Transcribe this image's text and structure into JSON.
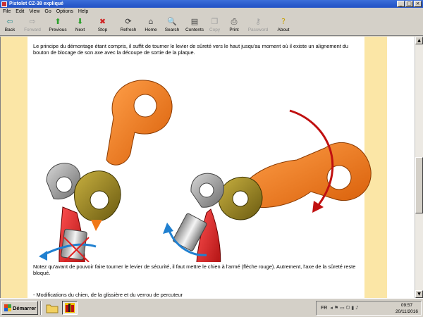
{
  "window": {
    "title": "Pistolet CZ-38 expliqué"
  },
  "menu": [
    "File",
    "Edit",
    "View",
    "Go",
    "Options",
    "Help"
  ],
  "toolbar": [
    {
      "label": "Back",
      "icon": "back-arrow-icon",
      "glyph": "⇦",
      "color": "#2f8f8f",
      "enabled": true
    },
    {
      "label": "Forward",
      "icon": "forward-arrow-icon",
      "glyph": "⇨",
      "color": "#a0a0a0",
      "enabled": false
    },
    {
      "label": "Previous",
      "icon": "up-arrow-icon",
      "glyph": "⬆",
      "color": "#2aa02a",
      "enabled": true
    },
    {
      "label": "Next",
      "icon": "down-arrow-icon",
      "glyph": "⬇",
      "color": "#2aa02a",
      "enabled": true
    },
    {
      "label": "Stop",
      "icon": "stop-icon",
      "glyph": "✖",
      "color": "#d02020",
      "enabled": true
    },
    {
      "label": "Refresh",
      "icon": "refresh-icon",
      "glyph": "⟳",
      "color": "#333333",
      "enabled": true
    },
    {
      "label": "Home",
      "icon": "home-icon",
      "glyph": "⌂",
      "color": "#555555",
      "enabled": true
    },
    {
      "label": "Search",
      "icon": "search-icon",
      "glyph": "🔍",
      "color": "#444444",
      "enabled": true
    },
    {
      "label": "Contents",
      "icon": "contents-icon",
      "glyph": "▤",
      "color": "#444444",
      "enabled": true
    },
    {
      "label": "Copy",
      "icon": "copy-icon",
      "glyph": "❐",
      "color": "#a0a0a0",
      "enabled": false
    },
    {
      "label": "Print",
      "icon": "print-icon",
      "glyph": "⎙",
      "color": "#444444",
      "enabled": true
    },
    {
      "label": "Password",
      "icon": "key-icon",
      "glyph": "⚷",
      "color": "#a0a0a0",
      "enabled": false
    },
    {
      "label": "About",
      "icon": "about-icon",
      "glyph": "?",
      "color": "#c8a000",
      "enabled": true
    }
  ],
  "content": {
    "para1": "Le principe du démontage étant compris, il suffit de tourner le levier de sûreté vers le haut jusqu'au moment où il existe un alignement du bouton de blocage de son axe avec la découpe de sortie de la plaque.",
    "para2": "Notez qu'avant de pouvoir faire tourner le levier de sécurité, il faut mettre le chien à l'armé (flèche rouge). Autrement, l'axe de la sûreté reste bloqué.",
    "para3": "- Modifications du chien, de la glissière et du verrou de percuteur"
  },
  "taskbar": {
    "start_label": "Démarrer",
    "language": "FR",
    "time": "09:57",
    "date": "20/11/2016"
  },
  "colors": {
    "side_band": "#fbe6a6",
    "orange_part": "#f07818",
    "red_part": "#d41c1c",
    "grey_part": "#8c8c8c",
    "olive_part": "#8a7a1a",
    "blue_arrow": "#2080d0"
  }
}
